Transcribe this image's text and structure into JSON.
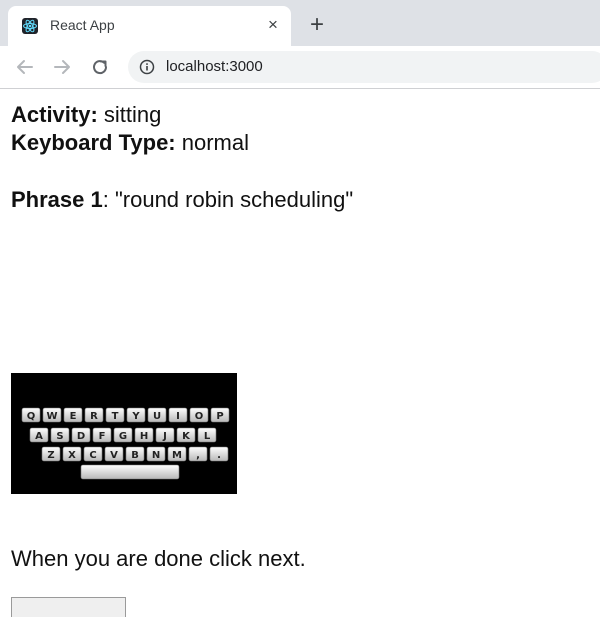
{
  "browser": {
    "tab_title": "React App",
    "tab_close_glyph": "×",
    "new_tab_glyph": "+",
    "url": "localhost:3000"
  },
  "page": {
    "activity_label": "Activity:",
    "activity_value": "sitting",
    "keyboard_label": "Keyboard Type:",
    "keyboard_value": "normal",
    "phrase_label": "Phrase 1",
    "phrase_value": ": \"round robin scheduling\"",
    "instruction": "When you are done click next.",
    "keyboard_rows": [
      [
        "Q",
        "W",
        "E",
        "R",
        "T",
        "Y",
        "U",
        "I",
        "O",
        "P"
      ],
      [
        "A",
        "S",
        "D",
        "F",
        "G",
        "H",
        "J",
        "K",
        "L"
      ],
      [
        "Z",
        "X",
        "C",
        "V",
        "B",
        "N",
        "M",
        ",",
        "."
      ]
    ]
  },
  "icons": {
    "favicon": "react-logo-icon",
    "back": "arrow-left-icon",
    "forward": "arrow-right-icon",
    "reload": "reload-icon",
    "site_info": "info-icon"
  },
  "colors": {
    "tab_strip": "#dee1e6",
    "omnibox": "#f1f3f4",
    "react_blue": "#61dafb"
  }
}
